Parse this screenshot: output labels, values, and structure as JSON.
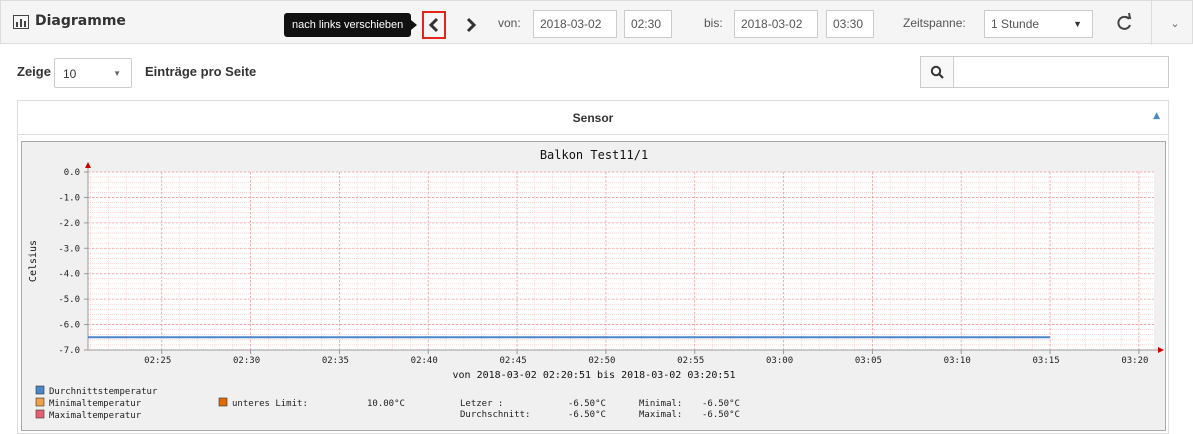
{
  "header": {
    "title": "Diagramme",
    "tooltip": "nach links verschieben",
    "von_label": "von:",
    "von_date": "2018-03-02",
    "von_time": "02:30",
    "bis_label": "bis:",
    "bis_date": "2018-03-02",
    "bis_time": "03:30",
    "zeitspanne_label": "Zeitspanne:",
    "zeitspanne_value": "1 Stunde"
  },
  "table_controls": {
    "zeige_label": "Zeige",
    "page_size": "10",
    "entries_label": "Einträge pro Seite",
    "search_value": ""
  },
  "table": {
    "column_header": "Sensor"
  },
  "chart_data": {
    "type": "line",
    "title": "Balkon Test11/1",
    "ylabel": "Celsius",
    "xlabel": "von 2018-03-02 02:20:51 bis 2018-03-02 03:20:51",
    "ylim": [
      -7.0,
      0.0
    ],
    "y_ticks": [
      "0.0",
      "-1.0",
      "-2.0",
      "-3.0",
      "-4.0",
      "-5.0",
      "-6.0",
      "-7.0"
    ],
    "x_ticks": [
      "02:25",
      "02:30",
      "02:35",
      "02:40",
      "02:45",
      "02:50",
      "02:55",
      "03:00",
      "03:05",
      "03:10",
      "03:15",
      "03:20"
    ],
    "series": [
      {
        "name": "Durchnittstemperatur",
        "color": "#4a86c8",
        "x": [
          "02:20:51",
          "03:15"
        ],
        "values": [
          -6.5,
          -6.5
        ]
      }
    ],
    "legend": [
      {
        "label": "Durchnittstemperatur",
        "color": "#4a86c8"
      },
      {
        "label": "Minimaltemperatur",
        "color": "#f0a048"
      },
      {
        "label": "Maximaltemperatur",
        "color": "#e86070"
      }
    ],
    "limit": {
      "label": "unteres Limit:",
      "value": "10.00°C",
      "color": "#e06a00"
    },
    "stats": {
      "letzer_label": "Letzer     :",
      "letzer": "-6.50°C",
      "durchschnitt_label": "Durchschnitt:",
      "durchschnitt": "-6.50°C",
      "minimal_label": "Minimal:",
      "minimal": "-6.50°C",
      "maximal_label": "Maximal:",
      "maximal": "-6.50°C"
    }
  },
  "colors": {
    "grid_minor": "#f3c4c4",
    "grid_major": "#e8a0a0",
    "axis": "#999999",
    "arrow": "#cc0000",
    "highlight": "#e3241b"
  }
}
